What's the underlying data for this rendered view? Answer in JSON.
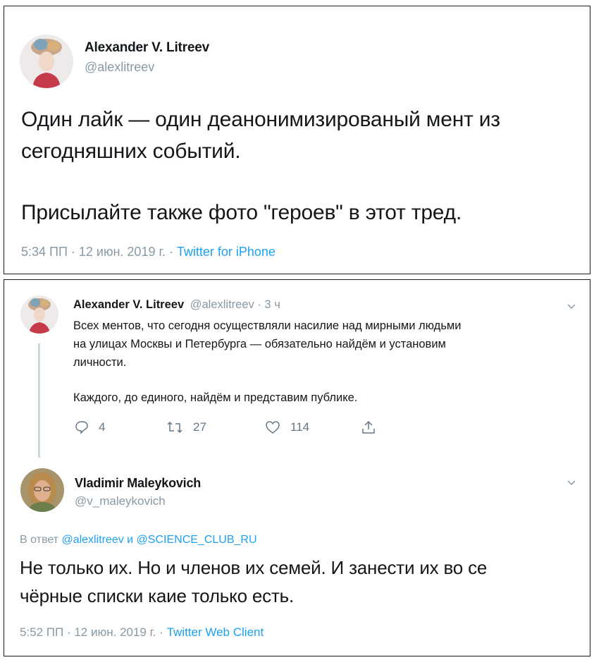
{
  "tweet1": {
    "name": "Alexander V. Litreev",
    "handle": "@alexlitreev",
    "line1": "Один лайк — один деанонимизированый мент из",
    "line2": "сегодняшних событий.",
    "line3": "Присылайте также фото \"героев\" в этот тред.",
    "time": "5:34 ПП · 12 июн. 2019 г. · ",
    "source": "Twitter for iPhone"
  },
  "tweet2": {
    "name": "Alexander V. Litreev",
    "handle_time": "@alexlitreev · 3 ч",
    "line1": "Всех ментов, что сегодня осуществляли насилие над мирными людьми",
    "line2": "на улицах Москвы и Петербурга — обязательно найдём и установим",
    "line3": "личности.",
    "line4": "Каждого, до единого, найдём и представим публике.",
    "replies": "4",
    "retweets": "27",
    "likes": "114"
  },
  "tweet3": {
    "name": "Vladimir Maleykovich",
    "handle": "@v_maleykovich",
    "reply_prefix": "В ответ ",
    "reply_user1": "@alexlitreev",
    "reply_and": " и ",
    "reply_user2": "@SCIENCE_CLUB_RU",
    "line1": "Не только их. Но и членов их семей. И занести их во се",
    "line2": "чёрные списки каие только есть.",
    "time": "5:52 ПП · 12 июн. 2019 г. · ",
    "source": "Twitter Web Client"
  },
  "icons": {
    "reply": "reply-icon",
    "retweet": "retweet-icon",
    "like": "heart-icon",
    "share": "share-icon",
    "chevron": "chevron-down-icon"
  },
  "colors": {
    "link": "#1da1f2",
    "muted": "#8899a6",
    "text": "#14171a"
  }
}
